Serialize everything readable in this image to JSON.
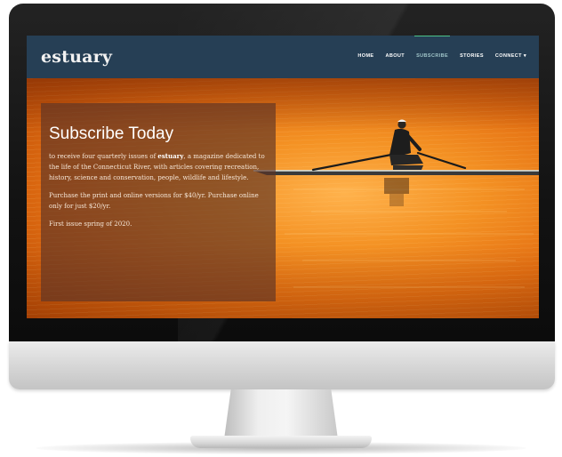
{
  "site": {
    "logo": "estuary"
  },
  "nav": {
    "items": [
      {
        "label": "HOME"
      },
      {
        "label": "ABOUT"
      },
      {
        "label": "SUBSCRIBE"
      },
      {
        "label": "STORIES"
      },
      {
        "label": "CONNECT ▾"
      }
    ],
    "active_index": 2
  },
  "hero": {
    "title": "Subscribe Today",
    "paragraph1_before": "to receive four quarterly issues of ",
    "paragraph1_brand": "estuary",
    "paragraph1_after": ", a magazine dedicated to the life of the Connecticut River, with articles covering recreation, history, science and conservation, people, wildlife and lifestyle.",
    "paragraph2": "Purchase the print and online versions for $40/yr. Purchase online only for just $20/yr.",
    "paragraph3": "First issue spring of 2020."
  },
  "colors": {
    "navbar": "#263f55",
    "active_nav": "#4cc38a",
    "water": "#e07518",
    "card": "#5c3426"
  }
}
